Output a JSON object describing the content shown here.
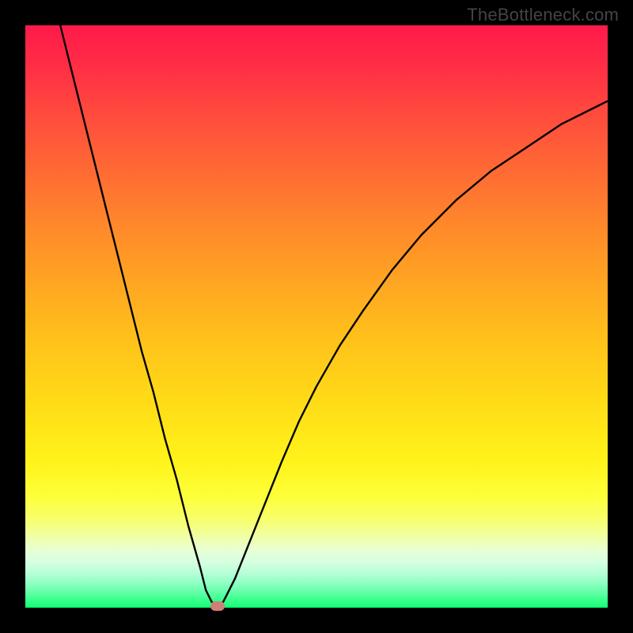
{
  "watermark": "TheBottleneck.com",
  "colors": {
    "frame": "#000000",
    "curve_stroke": "#000000",
    "marker_fill": "#cd8079"
  },
  "chart_data": {
    "type": "line",
    "title": "",
    "xlabel": "",
    "ylabel": "",
    "xlim": [
      0,
      100
    ],
    "ylim": [
      0,
      100
    ],
    "grid": false,
    "legend": false,
    "series": [
      {
        "name": "bottleneck-curve",
        "x": [
          6,
          8,
          10,
          12,
          14,
          16,
          18,
          20,
          22,
          24,
          26,
          28,
          30,
          31,
          32,
          33,
          34,
          36,
          38,
          40,
          42,
          44,
          47,
          50,
          54,
          58,
          63,
          68,
          74,
          80,
          86,
          92,
          98,
          100
        ],
        "y": [
          100,
          92,
          84,
          76,
          68,
          60,
          52,
          44,
          37,
          29,
          22,
          14,
          7,
          3,
          1,
          0.3,
          1,
          5,
          10,
          15,
          20,
          25,
          32,
          38,
          45,
          51,
          58,
          64,
          70,
          75,
          79,
          83,
          86,
          87
        ]
      }
    ],
    "marker": {
      "x": 33,
      "y": 0.3
    }
  }
}
